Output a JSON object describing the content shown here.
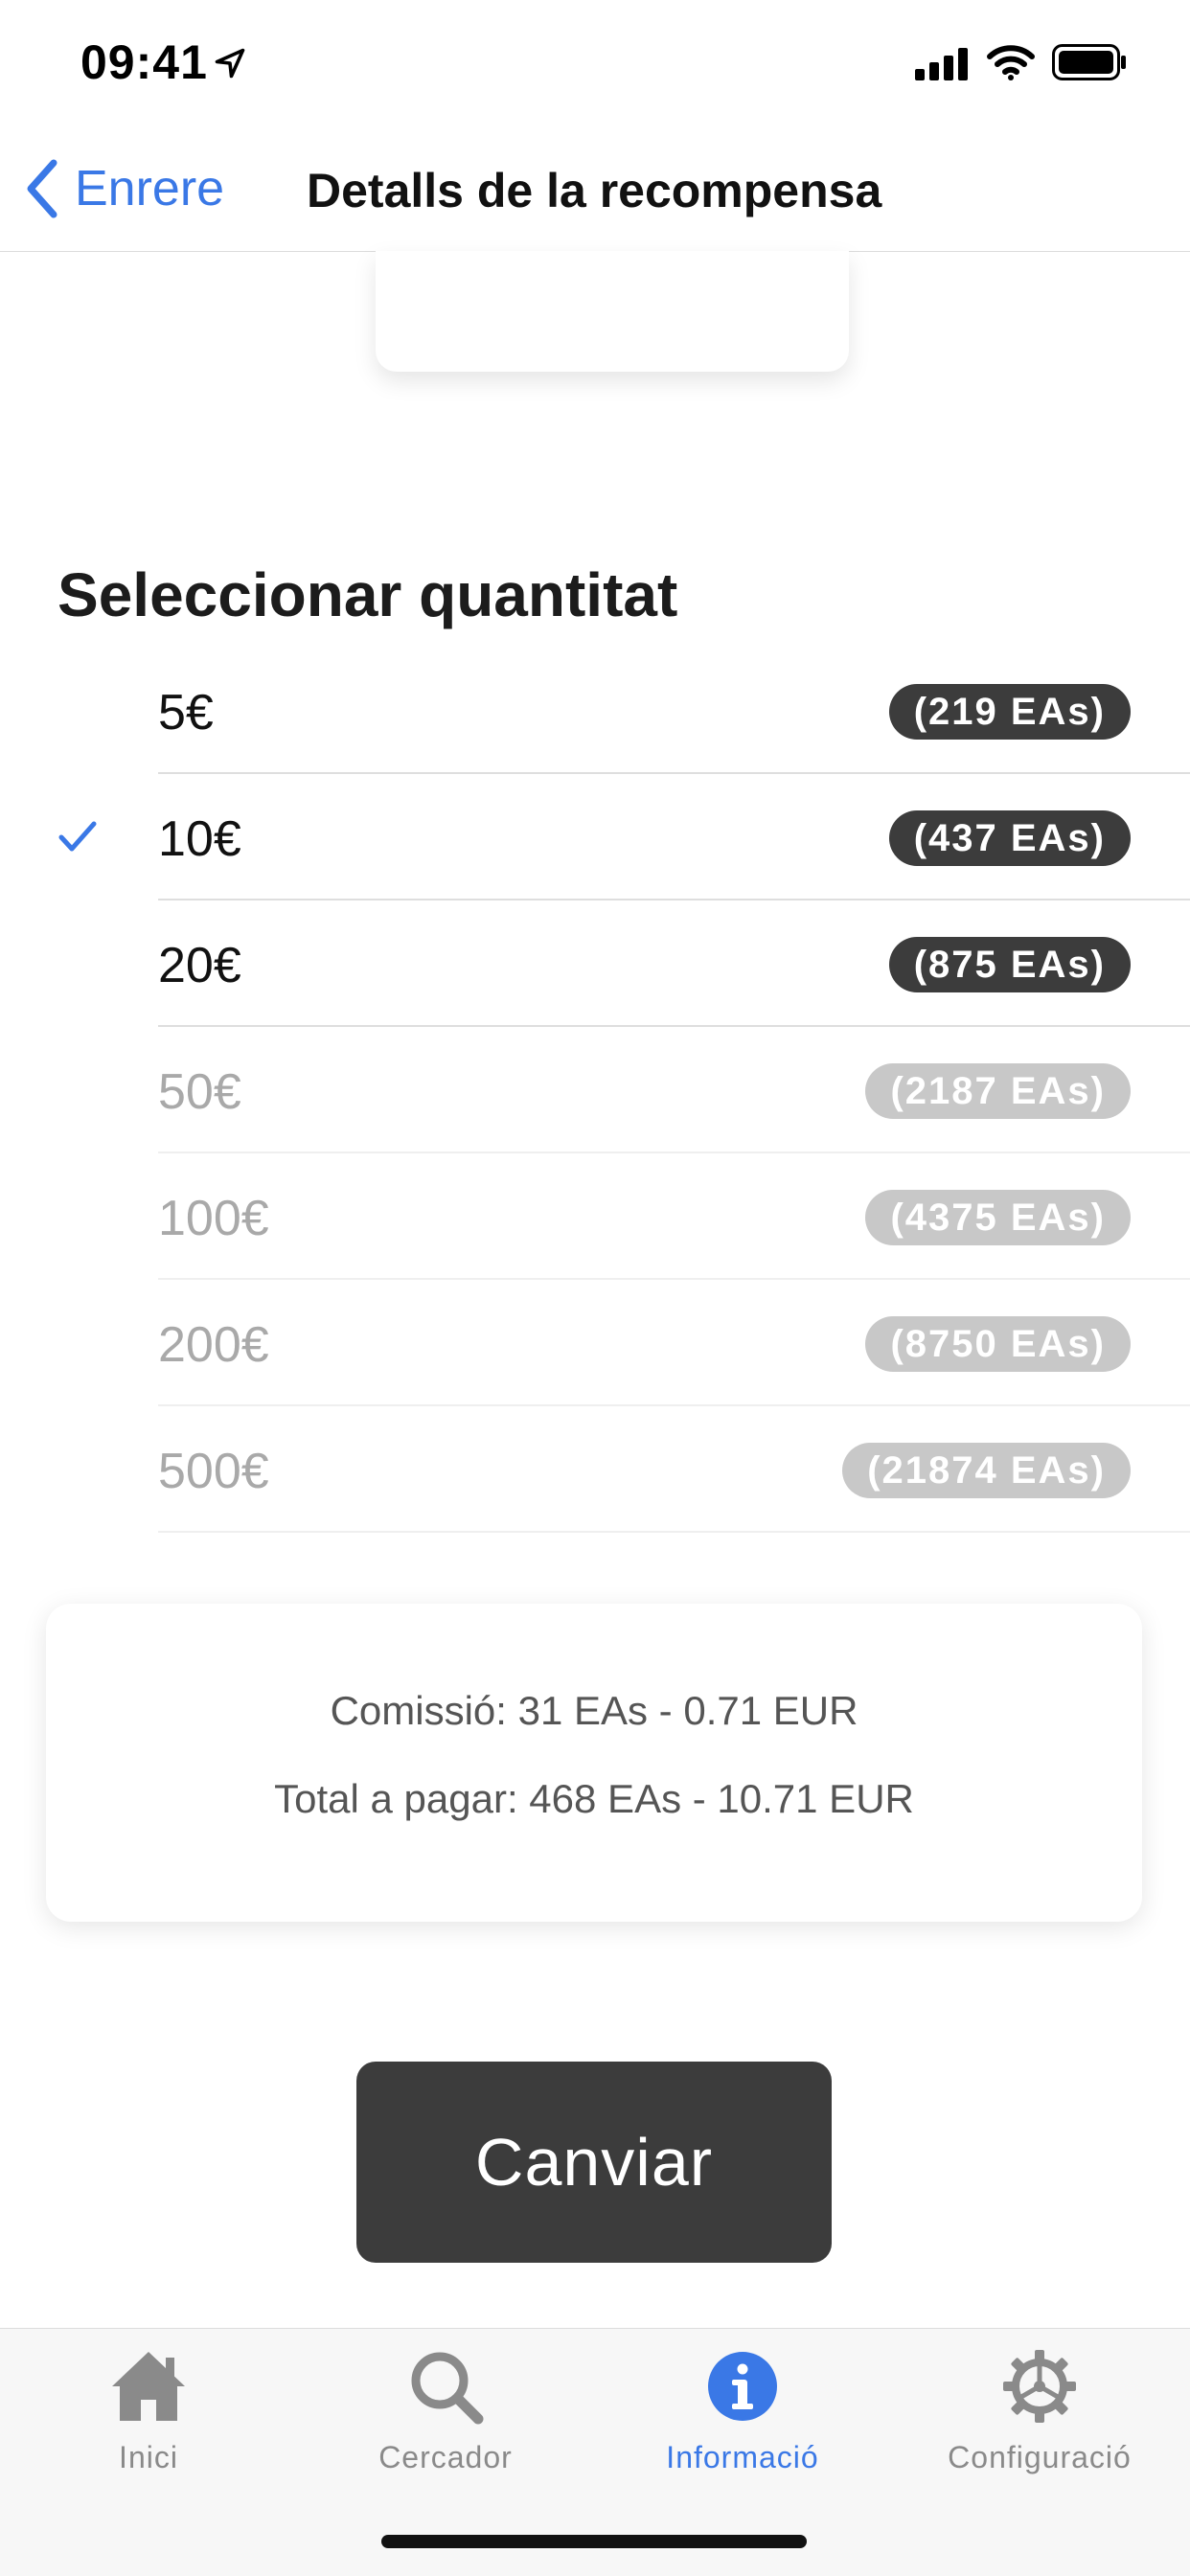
{
  "status_bar": {
    "time": "09:41"
  },
  "nav": {
    "back_label": "Enrere",
    "title": "Detalls de la recompensa"
  },
  "section": {
    "title": "Seleccionar quantitat"
  },
  "amounts": [
    {
      "label": "5€",
      "eas": "(219 EAs)",
      "selected": false,
      "enabled": true
    },
    {
      "label": "10€",
      "eas": "(437 EAs)",
      "selected": true,
      "enabled": true
    },
    {
      "label": "20€",
      "eas": "(875 EAs)",
      "selected": false,
      "enabled": true
    },
    {
      "label": "50€",
      "eas": "(2187 EAs)",
      "selected": false,
      "enabled": false
    },
    {
      "label": "100€",
      "eas": "(4375 EAs)",
      "selected": false,
      "enabled": false
    },
    {
      "label": "200€",
      "eas": "(8750 EAs)",
      "selected": false,
      "enabled": false
    },
    {
      "label": "500€",
      "eas": "(21874 EAs)",
      "selected": false,
      "enabled": false
    }
  ],
  "summary": {
    "fee": "Comissió: 31 EAs - 0.71 EUR",
    "total": "Total a pagar: 468 EAs - 10.71 EUR"
  },
  "exchange_button": {
    "label": "Canviar"
  },
  "tabs": [
    {
      "label": "Inici",
      "icon": "home-icon",
      "active": false
    },
    {
      "label": "Cercador",
      "icon": "search-icon",
      "active": false
    },
    {
      "label": "Informació",
      "icon": "info-icon",
      "active": true
    },
    {
      "label": "Configuració",
      "icon": "gear-icon",
      "active": false
    }
  ],
  "colors": {
    "accent": "#3a78e6",
    "badge_active": "#3c3c3c",
    "badge_disabled": "#c8c8c8",
    "button": "#3c3c3c"
  }
}
